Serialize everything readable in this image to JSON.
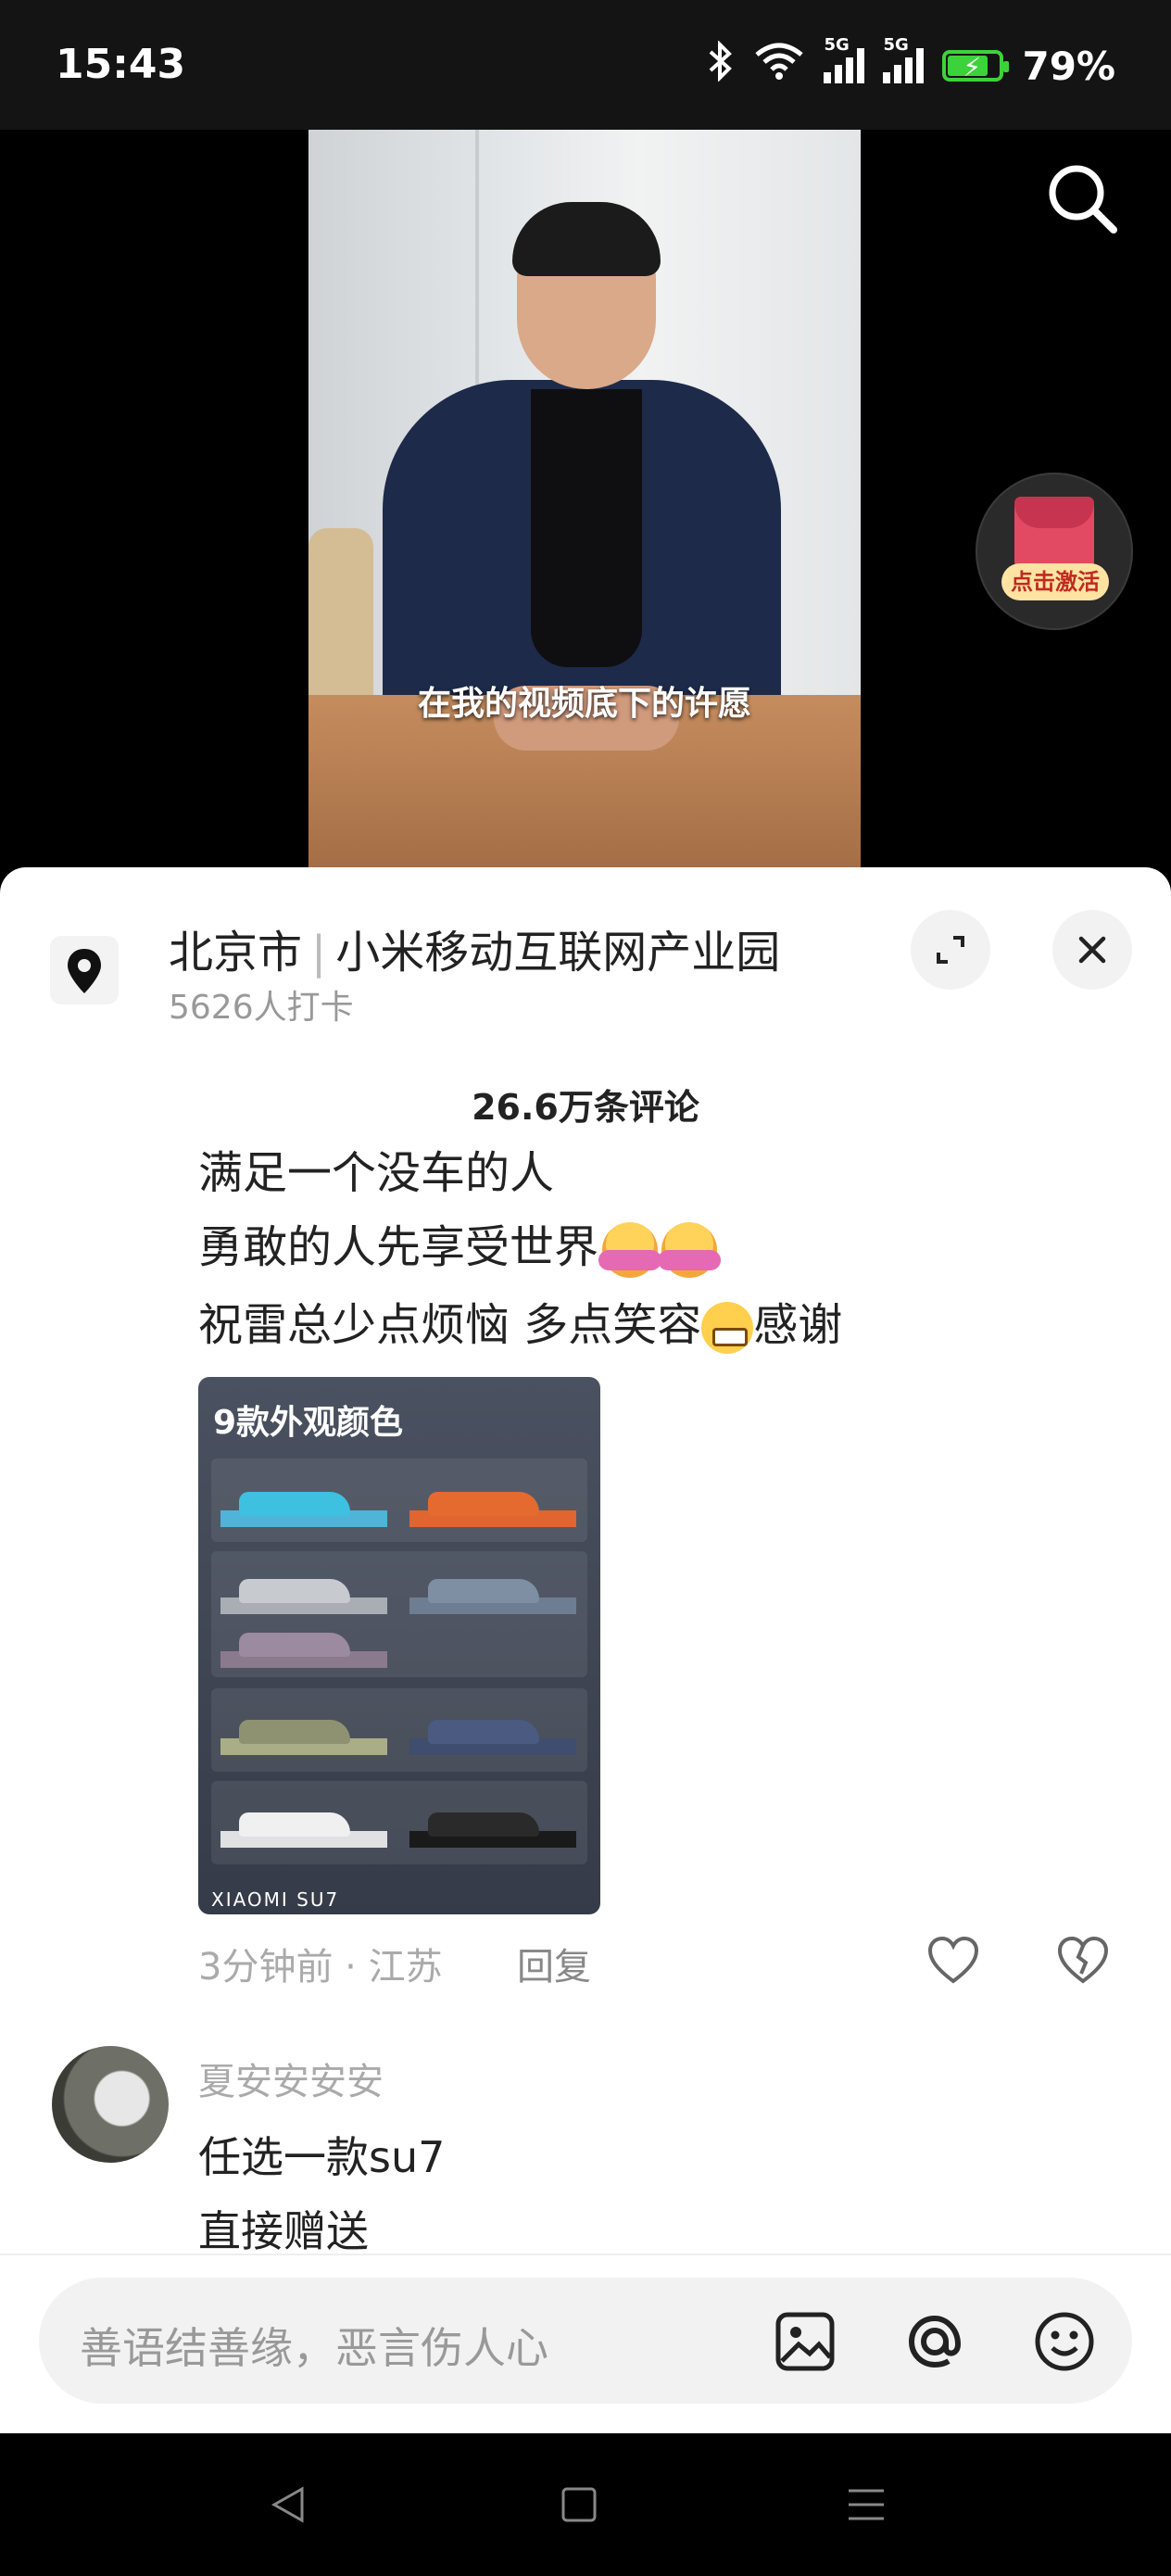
{
  "status": {
    "time": "15:43",
    "battery": "79%",
    "battery_level": 0.79,
    "network_1": "5G",
    "network_2": "5G"
  },
  "video": {
    "subtitle": "在我的视频底下的许愿",
    "promo_label": "点击激活"
  },
  "location": {
    "city": "北京市",
    "place": "小米移动互联网产业园",
    "checkins": "5626人打卡"
  },
  "comments": {
    "count": "26.6万条评论",
    "first": {
      "lines": [
        "满足一个没车的人",
        "勇敢的人先享受世界",
        "祝雷总少点烦恼 多点笑容",
        "感谢"
      ],
      "image_title": "9款外观颜色",
      "image_footer": "XIAOMI SU7",
      "time": "3分钟前 · 江苏",
      "reply": "回复"
    },
    "second": {
      "user": "夏安安安安",
      "lines": [
        "任选一款su7",
        "直接赠送"
      ]
    }
  },
  "input": {
    "placeholder": "善语结善缘，恶言伤人心"
  },
  "colors": {
    "accent_battery": "#3cd33a",
    "sheet_bg": "#ffffff",
    "promo_red": "#e24a63"
  },
  "icons": [
    "bluetooth-icon",
    "wifi-icon",
    "search-icon",
    "location-pin-icon",
    "expand-icon",
    "close-icon",
    "heart-icon",
    "broken-heart-icon",
    "image-icon",
    "at-icon",
    "emoji-icon",
    "back-icon",
    "home-icon",
    "menu-icon"
  ]
}
